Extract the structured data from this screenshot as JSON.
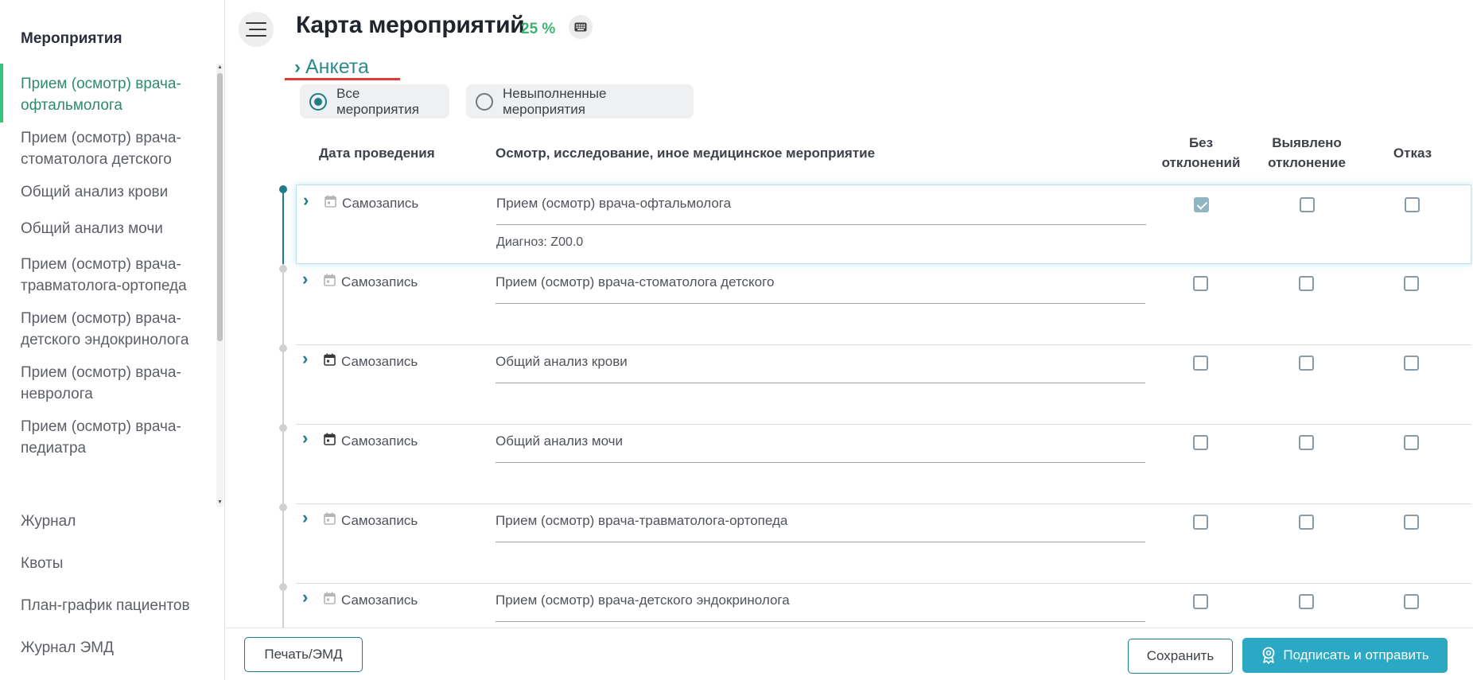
{
  "sidebar": {
    "title": "Мероприятия",
    "items": [
      {
        "label": "Прием (осмотр) врача-офтальмолога",
        "active": true
      },
      {
        "label": "Прием (осмотр) врача-стоматолога детского",
        "active": false
      },
      {
        "label": "Общий анализ крови",
        "active": false
      },
      {
        "label": "Общий анализ мочи",
        "active": false
      },
      {
        "label": "Прием (осмотр) врача-травматолога-ортопеда",
        "active": false
      },
      {
        "label": "Прием (осмотр) врача-детского эндокринолога",
        "active": false
      },
      {
        "label": "Прием (осмотр) врача-невролога",
        "active": false
      },
      {
        "label": "Прием (осмотр) врача-педиатра",
        "active": false
      }
    ],
    "bottom": [
      "Журнал",
      "Квоты",
      "План-график пациентов",
      "Журнал ЭМД"
    ]
  },
  "header": {
    "title": "Карта мероприятий",
    "percent": "25 %",
    "section": "Анкета"
  },
  "filters": {
    "all": "Все мероприятия",
    "pending": "Невыполненные мероприятия",
    "selected": "all"
  },
  "table": {
    "col_date": "Дата проведения",
    "col_event": "Осмотр, исследование, иное медицинское мероприятие",
    "col_ok_1": "Без",
    "col_ok_2": "отклонений",
    "col_dev_1": "Выявлено",
    "col_dev_2": "отклонение",
    "col_refuse": "Отказ",
    "rows": [
      {
        "date": "Самозапись",
        "event": "Прием (осмотр) врача-офтальмолога",
        "diagnosis": "Диагноз: Z00.0",
        "no_dev": true,
        "dev": false,
        "refuse": false,
        "cal": "calendar-icon-muted",
        "active": true
      },
      {
        "date": "Самозапись",
        "event": "Прием (осмотр) врача-стоматолога детского",
        "diagnosis": "",
        "no_dev": false,
        "dev": false,
        "refuse": false,
        "cal": "calendar-icon-muted",
        "active": false
      },
      {
        "date": "Самозапись",
        "event": "Общий анализ крови",
        "diagnosis": "",
        "no_dev": false,
        "dev": false,
        "refuse": false,
        "cal": "calendar-icon",
        "active": false
      },
      {
        "date": "Самозапись",
        "event": "Общий анализ мочи",
        "diagnosis": "",
        "no_dev": false,
        "dev": false,
        "refuse": false,
        "cal": "calendar-icon",
        "active": false
      },
      {
        "date": "Самозапись",
        "event": "Прием (осмотр) врача-травматолога-ортопеда",
        "diagnosis": "",
        "no_dev": false,
        "dev": false,
        "refuse": false,
        "cal": "calendar-icon-muted",
        "active": false
      },
      {
        "date": "Самозапись",
        "event": "Прием (осмотр) врача-детского эндокринолога",
        "diagnosis": "",
        "no_dev": false,
        "dev": false,
        "refuse": false,
        "cal": "calendar-icon-muted",
        "active": false
      }
    ]
  },
  "footer": {
    "print": "Печать/ЭМД",
    "save": "Сохранить",
    "sign": "Подписать и отправить"
  },
  "colors": {
    "accent": "#1f7c86",
    "primary_button": "#2aa8c4",
    "active_menu": "#2e8b69",
    "percent": "#3cb371",
    "underline_red": "#e53935"
  }
}
